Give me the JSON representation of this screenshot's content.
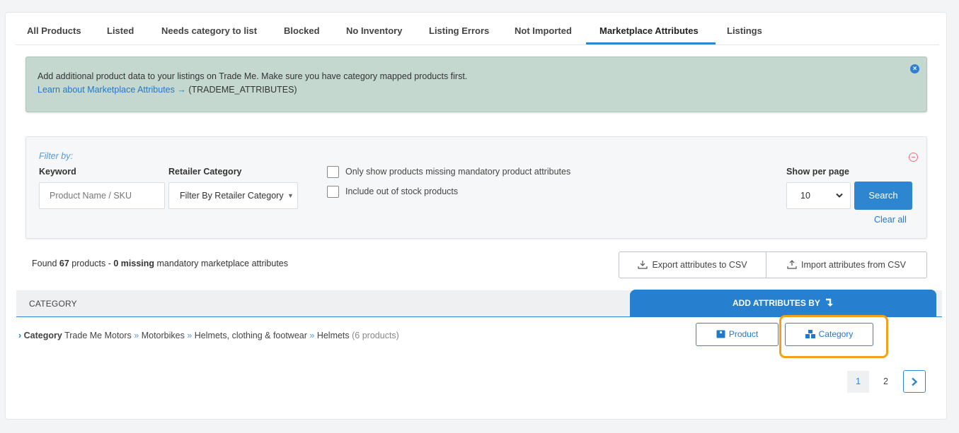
{
  "tabs": [
    {
      "label": "All Products"
    },
    {
      "label": "Listed"
    },
    {
      "label": "Needs category to list"
    },
    {
      "label": "Blocked"
    },
    {
      "label": "No Inventory"
    },
    {
      "label": "Listing Errors"
    },
    {
      "label": "Not Imported"
    },
    {
      "label": "Marketplace Attributes",
      "active": true
    },
    {
      "label": "Listings"
    }
  ],
  "banner": {
    "text": "Add additional product data to your listings on Trade Me. Make sure you have category mapped products first.",
    "link": "Learn about Marketplace Attributes",
    "link_arrow": "→",
    "code": "(TRADEME_ATTRIBUTES)",
    "close_icon": "close-circle-icon"
  },
  "filter": {
    "heading": "Filter by:",
    "keyword_label": "Keyword",
    "keyword_placeholder": "Product Name / SKU",
    "keyword_value": "",
    "category_label": "Retailer Category",
    "category_value": "Filter By Retailer Category",
    "checkbox_missing": "Only show products missing mandatory product attributes",
    "checkbox_missing_checked": false,
    "checkbox_out_of_stock": "Include out of stock products",
    "checkbox_out_of_stock_checked": false,
    "per_page_label": "Show per page",
    "per_page_value": "10",
    "search_label": "Search",
    "clear_label": "Clear all"
  },
  "summary": {
    "prefix": "Found ",
    "count": "67",
    "middle": " products - ",
    "missing": "0 missing",
    "suffix": " mandatory marketplace attributes"
  },
  "actions": {
    "export_label": "Export attributes to CSV",
    "import_label": "Import attributes from CSV"
  },
  "table": {
    "col_category": "CATEGORY",
    "col_add": "ADD ATTRIBUTES BY",
    "row": {
      "label": "Category",
      "path": [
        "Trade Me Motors",
        "Motorbikes",
        "Helmets, clothing & footwear",
        "Helmets"
      ],
      "separator": "»",
      "count": "(6 products)",
      "product_button": "Product",
      "category_button": "Category"
    }
  },
  "pagination": {
    "pages": [
      "1",
      "2"
    ],
    "current": "1"
  },
  "colors": {
    "accent": "#2e86d0",
    "banner_bg": "#c4d8d0",
    "highlight": "#f0a21a"
  }
}
